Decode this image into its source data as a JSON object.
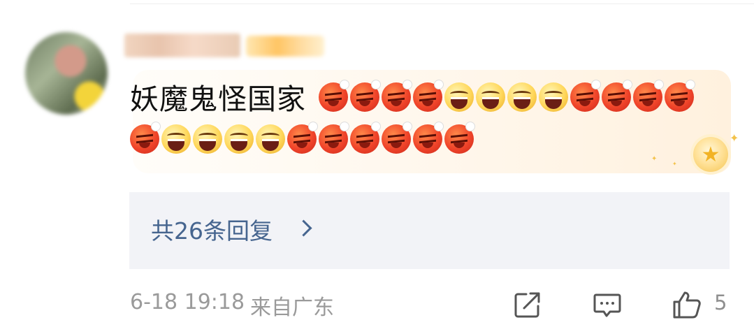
{
  "comment": {
    "text": "妖魔鬼怪国家",
    "emojis_line1": [
      "angry",
      "angry",
      "angry",
      "angry",
      "laugh",
      "laugh",
      "laugh",
      "laugh",
      "angry",
      "angry",
      "angry",
      "angry"
    ],
    "emojis_line2": [
      "angry",
      "laugh",
      "laugh",
      "laugh",
      "laugh",
      "angry",
      "angry",
      "angry",
      "angry",
      "angry",
      "angry"
    ]
  },
  "replies": {
    "label": "共26条回复"
  },
  "meta": {
    "time": "6-18 19:18",
    "location": "来自广东"
  },
  "actions": {
    "like_count": "5",
    "icons": [
      "share-icon",
      "comment-icon",
      "like-icon"
    ]
  },
  "colors": {
    "link": "#46658f",
    "meta": "#9a9a9a",
    "replies_bg": "#f2f3f7"
  }
}
